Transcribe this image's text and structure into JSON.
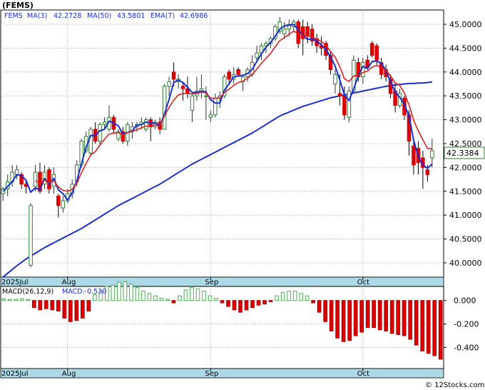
{
  "header": {
    "symbol": "(FEMS)",
    "ticker": "FEMS",
    "ma3_label": "MA(3)",
    "ma3_value": "42.2728",
    "ma50_label": "MA(50)",
    "ma50_value": "43.5801",
    "ema7_label": "EMA(7)",
    "ema7_value": "42.6986"
  },
  "last_price_label": "42.3384",
  "macd_header": {
    "params": "MACD(26,12,9)",
    "value_label": "MACD:-0.530"
  },
  "watermark": "© 12Stocks.com",
  "colors": {
    "up_candle": "#2e7d32",
    "down_candle": "#dd0000",
    "ma_blue": "#1a2ed6",
    "ema_red": "#e02020",
    "axis_band": "#add8e6",
    "macd_pos": "#4caf50",
    "macd_neg": "#dd0000"
  },
  "chart_data": [
    {
      "type": "candlestick",
      "title": "(FEMS)",
      "ylim": [
        39.7,
        45.3
      ],
      "y_ticks": [
        "45.0000",
        "44.5000",
        "44.0000",
        "43.5000",
        "43.0000",
        "42.5000",
        "42.0000",
        "41.5000",
        "41.0000",
        "40.5000",
        "40.0000"
      ],
      "y_tick_values": [
        45.0,
        44.5,
        44.0,
        43.5,
        43.0,
        42.5,
        42.0,
        41.5,
        41.0,
        40.5,
        40.0
      ],
      "x_ticks": [
        {
          "label": "2025Jul",
          "index": 0
        },
        {
          "label": "Aug",
          "index": 14
        },
        {
          "label": "Sep",
          "index": 45
        },
        {
          "label": "Oct",
          "index": 78
        }
      ],
      "num_sessions": 96,
      "ohlc": [
        [
          41.45,
          41.6,
          41.3,
          41.55
        ],
        [
          41.55,
          41.85,
          41.4,
          41.7
        ],
        [
          41.7,
          42.05,
          41.6,
          41.9
        ],
        [
          41.85,
          42.05,
          41.75,
          41.95
        ],
        [
          41.85,
          41.9,
          41.55,
          41.65
        ],
        [
          41.65,
          41.75,
          41.45,
          41.6
        ],
        [
          39.95,
          41.25,
          39.9,
          41.2
        ],
        [
          41.6,
          42.05,
          41.5,
          41.9
        ],
        [
          41.9,
          42.1,
          41.45,
          41.5
        ],
        [
          41.65,
          42.05,
          41.55,
          41.9
        ],
        [
          41.95,
          42.0,
          41.45,
          41.55
        ],
        [
          41.6,
          42.0,
          41.45,
          41.85
        ],
        [
          41.4,
          41.45,
          40.95,
          41.2
        ],
        [
          41.15,
          41.4,
          41.05,
          41.3
        ],
        [
          41.3,
          41.55,
          41.25,
          41.45
        ],
        [
          41.45,
          41.75,
          41.35,
          41.65
        ],
        [
          41.7,
          42.15,
          41.6,
          42.05
        ],
        [
          42.05,
          42.6,
          42.0,
          42.55
        ],
        [
          42.35,
          42.75,
          42.3,
          42.65
        ],
        [
          42.3,
          42.85,
          42.25,
          42.8
        ],
        [
          42.8,
          42.95,
          42.5,
          42.55
        ],
        [
          42.55,
          42.95,
          42.45,
          42.9
        ],
        [
          42.9,
          43.05,
          42.8,
          42.95
        ],
        [
          42.8,
          43.3,
          42.75,
          43.05
        ],
        [
          43.05,
          43.1,
          42.7,
          42.8
        ],
        [
          42.6,
          42.8,
          42.55,
          42.75
        ],
        [
          42.75,
          42.85,
          42.5,
          42.55
        ],
        [
          42.55,
          42.95,
          42.45,
          42.9
        ],
        [
          42.75,
          42.95,
          42.6,
          42.85
        ],
        [
          42.85,
          42.95,
          42.75,
          42.9
        ],
        [
          42.9,
          43.05,
          42.8,
          42.95
        ],
        [
          42.8,
          43.05,
          42.75,
          43.0
        ],
        [
          43.0,
          43.05,
          42.55,
          42.85
        ],
        [
          42.85,
          43.0,
          42.8,
          42.95
        ],
        [
          42.95,
          43.05,
          42.7,
          42.8
        ],
        [
          42.8,
          43.75,
          42.8,
          43.7
        ],
        [
          43.7,
          43.9,
          43.5,
          43.8
        ],
        [
          44.0,
          44.2,
          43.7,
          43.85
        ],
        [
          43.8,
          43.95,
          43.65,
          43.85
        ],
        [
          43.7,
          43.8,
          43.4,
          43.65
        ],
        [
          43.65,
          43.9,
          43.45,
          43.55
        ],
        [
          43.2,
          43.55,
          42.95,
          43.5
        ],
        [
          43.5,
          43.9,
          43.4,
          43.6
        ],
        [
          43.6,
          43.95,
          43.45,
          43.65
        ],
        [
          43.5,
          43.7,
          43.0,
          43.5
        ],
        [
          43.05,
          43.2,
          42.95,
          43.1
        ],
        [
          43.1,
          43.55,
          43.05,
          43.45
        ],
        [
          43.45,
          43.6,
          43.25,
          43.5
        ],
        [
          43.5,
          43.95,
          43.45,
          43.9
        ],
        [
          44.0,
          44.05,
          43.75,
          43.85
        ],
        [
          43.85,
          44.1,
          43.75,
          43.95
        ],
        [
          44.05,
          44.1,
          43.9,
          43.95
        ],
        [
          43.8,
          43.95,
          43.6,
          43.9
        ],
        [
          43.9,
          44.1,
          43.8,
          44.05
        ],
        [
          43.95,
          44.35,
          43.9,
          44.2
        ],
        [
          44.3,
          44.55,
          44.2,
          44.4
        ],
        [
          44.4,
          44.6,
          44.25,
          44.55
        ],
        [
          44.55,
          44.65,
          44.4,
          44.6
        ],
        [
          44.6,
          44.75,
          44.5,
          44.7
        ],
        [
          44.7,
          45.0,
          44.65,
          44.95
        ],
        [
          44.85,
          45.15,
          44.8,
          45.05
        ],
        [
          44.8,
          45.05,
          44.7,
          44.9
        ],
        [
          44.9,
          45.1,
          44.75,
          45.0
        ],
        [
          44.95,
          45.1,
          44.85,
          45.05
        ],
        [
          45.05,
          45.1,
          44.5,
          44.6
        ],
        [
          44.95,
          45.1,
          44.35,
          44.7
        ],
        [
          44.95,
          45.05,
          44.6,
          44.75
        ],
        [
          44.9,
          45.0,
          44.55,
          44.65
        ],
        [
          44.7,
          44.8,
          44.4,
          44.55
        ],
        [
          44.55,
          44.75,
          44.35,
          44.5
        ],
        [
          44.6,
          44.65,
          44.25,
          44.35
        ],
        [
          44.35,
          44.45,
          43.95,
          44.05
        ],
        [
          43.75,
          44.05,
          43.55,
          43.95
        ],
        [
          43.55,
          43.95,
          43.3,
          43.5
        ],
        [
          43.5,
          43.7,
          43.0,
          43.1
        ],
        [
          43.05,
          43.7,
          42.95,
          43.6
        ],
        [
          43.6,
          44.35,
          43.55,
          44.25
        ],
        [
          44.2,
          44.3,
          43.8,
          43.9
        ],
        [
          43.9,
          44.3,
          43.75,
          44.2
        ],
        [
          44.25,
          44.35,
          44.05,
          44.1
        ],
        [
          44.6,
          44.65,
          44.3,
          44.35
        ],
        [
          44.55,
          44.6,
          44.15,
          44.25
        ],
        [
          44.2,
          44.3,
          43.85,
          43.95
        ],
        [
          44.05,
          44.15,
          43.8,
          43.9
        ],
        [
          43.85,
          43.95,
          43.45,
          43.55
        ],
        [
          43.6,
          43.75,
          43.15,
          43.3
        ],
        [
          43.3,
          43.65,
          43.25,
          43.55
        ],
        [
          43.45,
          43.5,
          43.0,
          43.1
        ],
        [
          43.1,
          43.2,
          42.25,
          42.55
        ],
        [
          42.45,
          42.55,
          41.85,
          42.05
        ],
        [
          42.4,
          42.55,
          41.85,
          42.1
        ],
        [
          42.2,
          42.35,
          41.55,
          42.0
        ],
        [
          41.95,
          42.05,
          41.7,
          41.85
        ],
        [
          42.2,
          42.6,
          42.0,
          42.35
        ],
        [
          null,
          null,
          null,
          null
        ],
        [
          null,
          null,
          null,
          null
        ]
      ],
      "series": [
        {
          "name": "MA(3)",
          "color": "#1a2ed6",
          "values": [
            41.5,
            41.6,
            41.7,
            41.85,
            41.83,
            41.73,
            41.48,
            41.57,
            41.53,
            41.77,
            41.65,
            41.77,
            41.53,
            41.45,
            41.32,
            41.47,
            41.72,
            42.08,
            42.42,
            42.67,
            42.67,
            42.77,
            42.8,
            42.97,
            42.93,
            42.87,
            42.7,
            42.73,
            42.77,
            42.88,
            42.9,
            42.95,
            42.93,
            42.93,
            42.87,
            43.12,
            43.43,
            43.78,
            43.83,
            43.78,
            43.68,
            43.57,
            43.57,
            43.6,
            43.58,
            43.42,
            43.35,
            43.35,
            43.62,
            43.75,
            43.9,
            43.92,
            43.93,
            43.97,
            44.05,
            44.22,
            44.38,
            44.52,
            44.62,
            44.75,
            44.9,
            44.97,
            44.98,
            45.0,
            44.88,
            44.78,
            44.68,
            44.7,
            44.65,
            44.57,
            44.47,
            44.32,
            44.12,
            43.83,
            43.52,
            43.4,
            43.65,
            43.92,
            44.12,
            44.07,
            44.22,
            44.23,
            44.18,
            44.03,
            43.8,
            43.58,
            43.47,
            43.32,
            43.07,
            42.57,
            42.23,
            42.05,
            41.98,
            42.07,
            null,
            null
          ]
        },
        {
          "name": "EMA(7)",
          "color": "#e02020",
          "values": [
            null,
            null,
            null,
            null,
            null,
            null,
            null,
            41.72,
            41.67,
            41.73,
            41.68,
            41.72,
            41.59,
            41.52,
            41.5,
            41.54,
            41.67,
            41.89,
            42.08,
            42.26,
            42.33,
            42.47,
            42.59,
            42.7,
            42.72,
            42.73,
            42.68,
            42.73,
            42.76,
            42.79,
            42.83,
            42.87,
            42.86,
            42.89,
            42.87,
            43.08,
            43.26,
            43.41,
            43.52,
            43.55,
            43.55,
            43.54,
            43.55,
            43.58,
            43.56,
            43.45,
            43.45,
            43.46,
            43.57,
            43.64,
            43.72,
            43.78,
            43.81,
            43.87,
            43.95,
            44.06,
            44.18,
            44.29,
            44.39,
            44.53,
            44.66,
            44.72,
            44.79,
            44.86,
            44.8,
            44.77,
            44.76,
            44.73,
            44.69,
            44.64,
            44.56,
            44.43,
            44.31,
            44.11,
            43.86,
            43.8,
            43.92,
            43.92,
            43.99,
            44.02,
            44.1,
            44.14,
            44.09,
            44.04,
            43.92,
            43.77,
            43.72,
            43.56,
            43.31,
            42.99,
            42.77,
            42.58,
            42.4,
            42.39,
            null,
            null
          ]
        },
        {
          "name": "MA(50)",
          "color": "#1a2ed6",
          "values": [
            39.7,
            39.78,
            39.86,
            39.94,
            40.01,
            40.08,
            40.14,
            40.2,
            40.26,
            40.32,
            40.37,
            40.42,
            40.47,
            40.52,
            40.57,
            40.62,
            40.67,
            40.72,
            40.78,
            40.84,
            40.9,
            40.96,
            41.02,
            41.08,
            41.14,
            41.2,
            41.25,
            41.3,
            41.35,
            41.4,
            41.45,
            41.5,
            41.55,
            41.6,
            41.65,
            41.71,
            41.77,
            41.83,
            41.89,
            41.95,
            42.01,
            42.07,
            42.12,
            42.17,
            42.22,
            42.27,
            42.32,
            42.37,
            42.42,
            42.47,
            42.52,
            42.57,
            42.62,
            42.67,
            42.72,
            42.78,
            42.84,
            42.9,
            42.96,
            43.02,
            43.08,
            43.12,
            43.16,
            43.2,
            43.24,
            43.28,
            43.31,
            43.34,
            43.37,
            43.4,
            43.43,
            43.46,
            43.48,
            43.5,
            43.52,
            43.54,
            43.56,
            43.58,
            43.6,
            43.62,
            43.64,
            43.66,
            43.68,
            43.7,
            43.72,
            43.73,
            43.74,
            43.75,
            43.76,
            43.76,
            43.77,
            43.77,
            43.78,
            43.79,
            null,
            null
          ]
        }
      ]
    },
    {
      "type": "bar",
      "title": "MACD(26,12,9)",
      "ylim": [
        -0.58,
        0.12
      ],
      "y_ticks": [
        "0.000",
        "-0.200",
        "-0.400"
      ],
      "y_tick_values": [
        0.0,
        -0.2,
        -0.4
      ],
      "x_ticks": [
        {
          "label": "2025Jul",
          "index": 0
        },
        {
          "label": "Aug",
          "index": 14
        },
        {
          "label": "Sep",
          "index": 45
        },
        {
          "label": "Oct",
          "index": 78
        }
      ],
      "values": [
        0.015,
        0.01,
        0.01,
        0.015,
        0.01,
        -0.06,
        -0.08,
        -0.07,
        -0.08,
        -0.09,
        -0.15,
        -0.18,
        -0.17,
        -0.15,
        -0.09,
        0.05,
        0.08,
        0.12,
        0.13,
        0.155,
        0.16,
        0.14,
        0.11,
        0.08,
        0.06,
        0.04,
        0.02,
        0.01,
        -0.02,
        0.04,
        0.09,
        0.11,
        0.1,
        0.08,
        0.04,
        0.02,
        -0.02,
        -0.05,
        -0.08,
        -0.1,
        -0.08,
        -0.06,
        -0.04,
        -0.03,
        -0.01,
        0.04,
        0.07,
        0.08,
        0.08,
        0.06,
        0.04,
        -0.02,
        -0.1,
        -0.18,
        -0.26,
        -0.32,
        -0.35,
        -0.34,
        -0.3,
        -0.27,
        -0.23,
        -0.23,
        -0.25,
        -0.26,
        -0.28,
        -0.29,
        -0.3,
        -0.33,
        -0.38,
        -0.43,
        -0.45,
        -0.47,
        -0.5
      ]
    }
  ]
}
